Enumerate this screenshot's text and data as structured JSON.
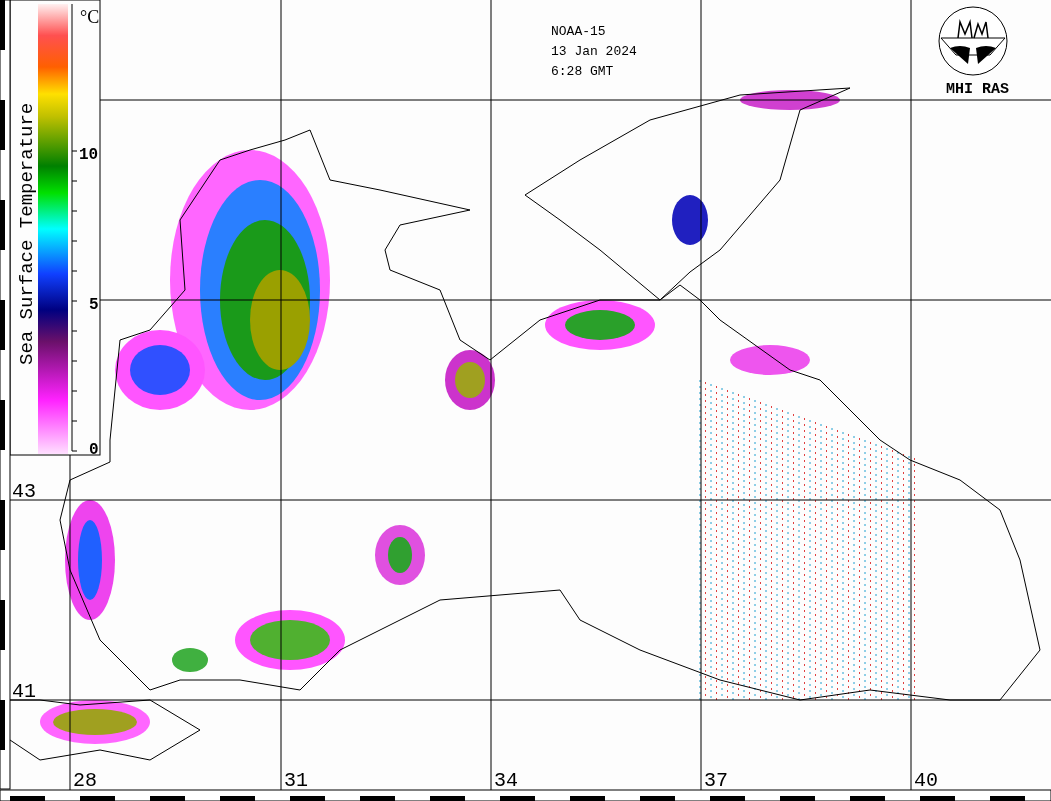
{
  "legend": {
    "title": "Sea Surface Temperature",
    "unit": "°C",
    "ticks": [
      "10",
      "5",
      "0"
    ]
  },
  "header": {
    "satellite": "NOAA-15",
    "date": "13 Jan 2024",
    "time": "6:28 GMT"
  },
  "logo": {
    "label": "MHI RAS"
  },
  "lat_labels": [
    "43",
    "41"
  ],
  "lon_labels": [
    "28",
    "31",
    "34",
    "37",
    "40"
  ]
}
